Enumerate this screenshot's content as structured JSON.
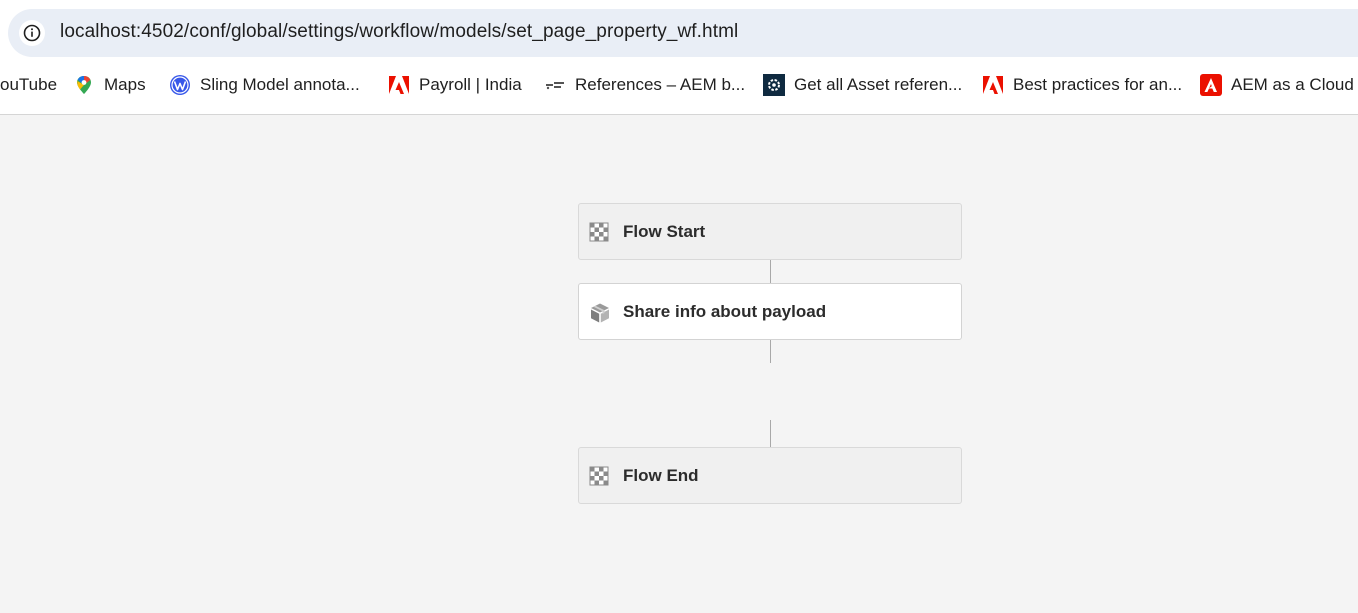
{
  "browser": {
    "url": "localhost:4502/conf/global/settings/workflow/models/set_page_property_wf.html",
    "bookmarks": [
      {
        "label": "ouTube",
        "icon": "youtube-icon"
      },
      {
        "label": "Maps",
        "icon": "google-maps-icon"
      },
      {
        "label": "Sling Model annota...",
        "icon": "wordpress-icon"
      },
      {
        "label": "Payroll | India",
        "icon": "adobe-icon"
      },
      {
        "label": "References – AEM b...",
        "icon": "bookmark-site-icon"
      },
      {
        "label": "Get all Asset referen...",
        "icon": "site-gear-icon"
      },
      {
        "label": "Best practices for an...",
        "icon": "adobe-icon"
      },
      {
        "label": "AEM as a Cloud S",
        "icon": "adobe-square-icon"
      }
    ]
  },
  "workflow": {
    "nodes": [
      {
        "label": "Flow Start",
        "type": "start",
        "icon": "flow-checker-icon"
      },
      {
        "label": "Share info about payload",
        "type": "step",
        "icon": "process-box-icon"
      },
      {
        "label": "Flow End",
        "type": "end",
        "icon": "flow-checker-icon"
      }
    ]
  },
  "colors": {
    "omnibox_bg": "#e9eef6",
    "canvas_bg": "#f4f4f4",
    "adobe_red": "#eb1000",
    "connector": "#a8a8a8"
  }
}
